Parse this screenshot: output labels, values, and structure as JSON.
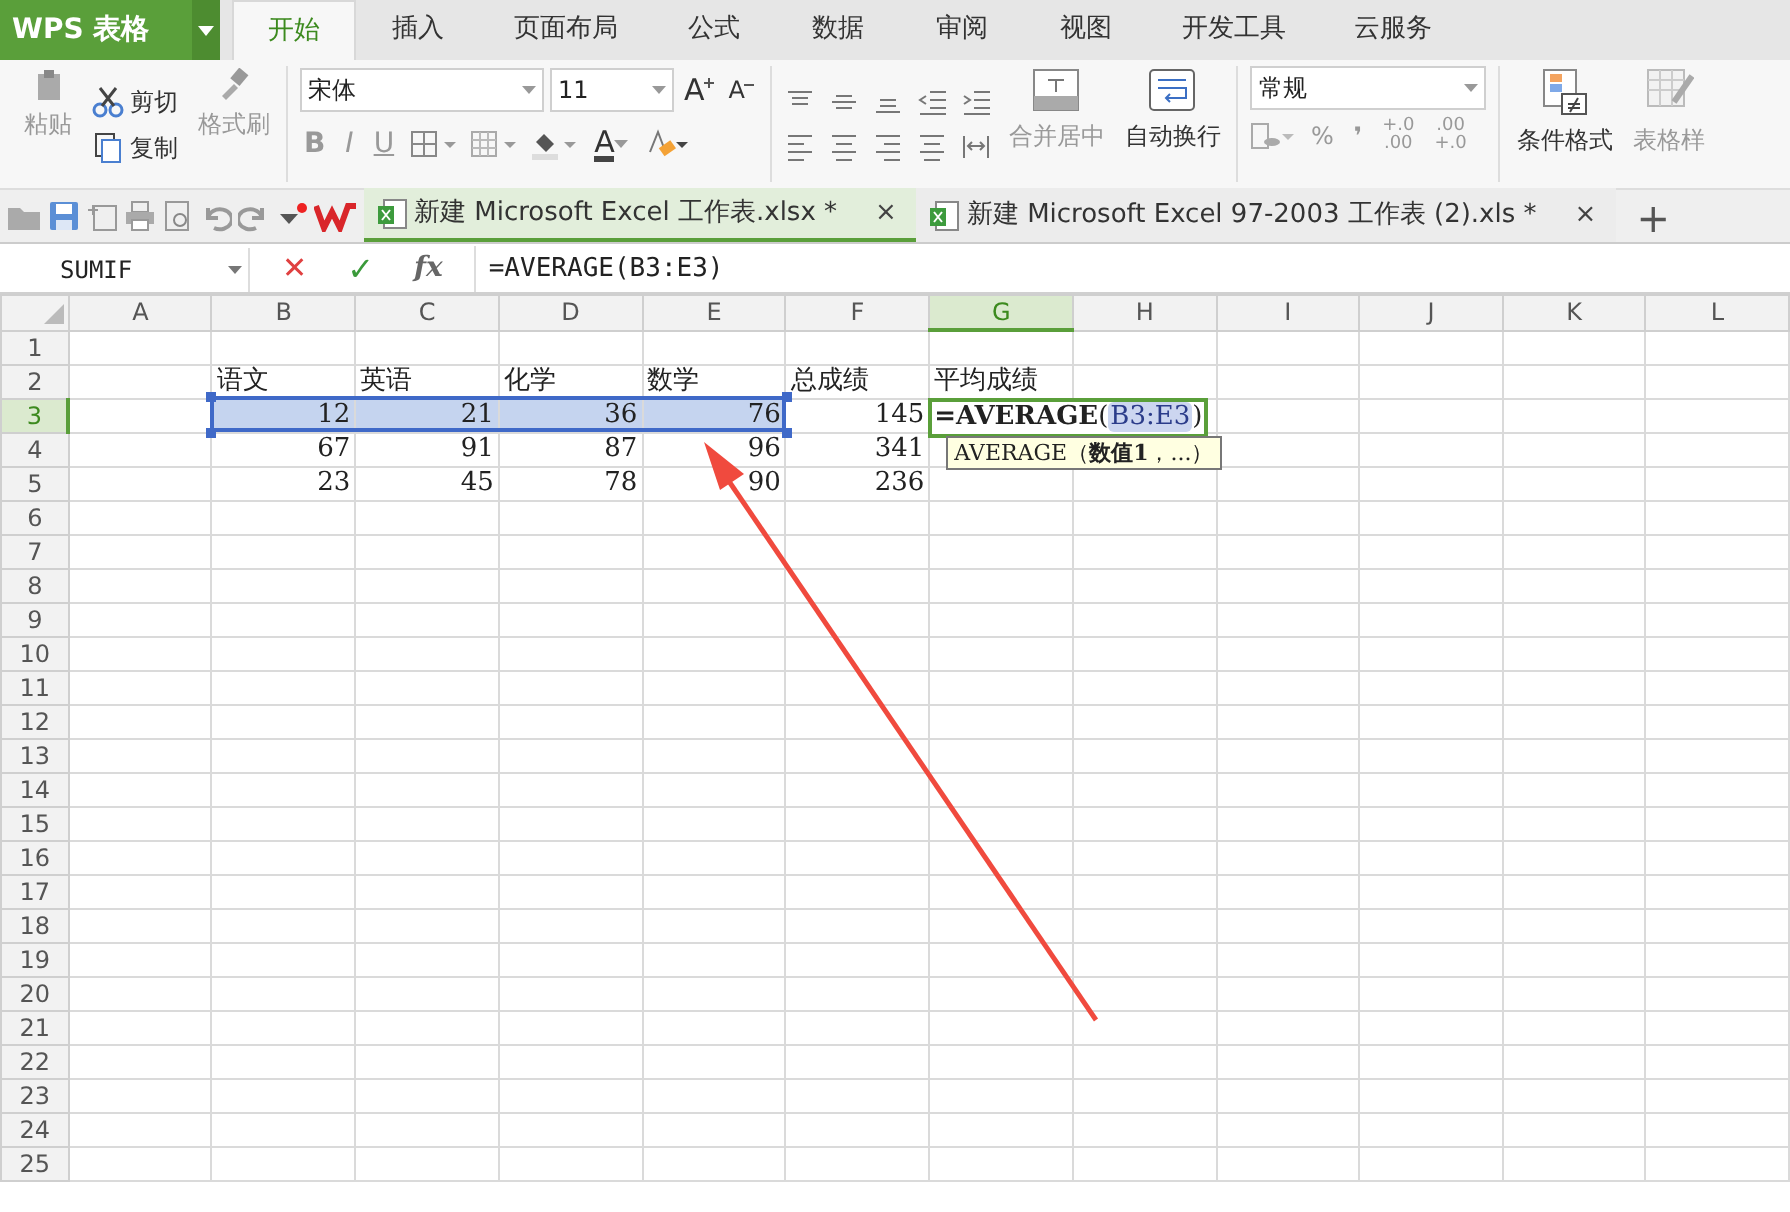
{
  "app": {
    "logo": "WPS 表格",
    "menu_tabs": [
      {
        "label": "开始",
        "selected": true
      },
      {
        "label": "插入",
        "selected": false
      },
      {
        "label": "页面布局",
        "selected": false
      },
      {
        "label": "公式",
        "selected": false
      },
      {
        "label": "数据",
        "selected": false
      },
      {
        "label": "审阅",
        "selected": false
      },
      {
        "label": "视图",
        "selected": false
      },
      {
        "label": "开发工具",
        "selected": false
      },
      {
        "label": "云服务",
        "selected": false
      }
    ]
  },
  "ribbon": {
    "clipboard": {
      "paste": "粘贴",
      "cut": "剪切",
      "copy": "复制",
      "format_painter": "格式刷"
    },
    "font": {
      "name": "宋体",
      "size": "11",
      "grow": "A",
      "shrink": "A",
      "styles": [
        "B",
        "I",
        "U"
      ],
      "color_letter": "A"
    },
    "alignment": {
      "merge": "合并居中",
      "wrap": "自动换行"
    },
    "number": {
      "format": "常规",
      "percent": "%",
      "comma": "❜",
      "decimals": [
        {
          "top": "+.0",
          "bottom": ".00"
        },
        {
          "top": ".00",
          "bottom": "+.0"
        }
      ]
    },
    "styles": {
      "conditional": "条件格式",
      "table_style": "表格样"
    }
  },
  "documents": [
    {
      "title": "新建 Microsoft Excel 工作表.xlsx *",
      "close": "×",
      "selected": true
    },
    {
      "title": "新建 Microsoft Excel 97-2003 工作表 (2).xls *",
      "close": "×",
      "selected": false
    }
  ],
  "new_tab": "+",
  "formula_bar": {
    "name_box": "SUMIF",
    "cancel": "✕",
    "enter": "✓",
    "fx": "fx",
    "formula": "=AVERAGE(B3:E3)"
  },
  "sheet": {
    "columns": [
      {
        "label": "A",
        "selected": false
      },
      {
        "label": "B",
        "selected": false
      },
      {
        "label": "C",
        "selected": false
      },
      {
        "label": "D",
        "selected": false
      },
      {
        "label": "E",
        "selected": false
      },
      {
        "label": "F",
        "selected": false
      },
      {
        "label": "G",
        "selected": true
      },
      {
        "label": "H",
        "selected": false
      },
      {
        "label": "I",
        "selected": false
      },
      {
        "label": "J",
        "selected": false
      },
      {
        "label": "K",
        "selected": false
      },
      {
        "label": "L",
        "selected": false
      }
    ],
    "rows": [
      {
        "label": "1",
        "selected": false
      },
      {
        "label": "2",
        "selected": false,
        "cells": [
          null,
          {
            "text": "语文",
            "kind": "text",
            "highlighted": false
          },
          {
            "text": "英语",
            "kind": "text",
            "highlighted": false
          },
          {
            "text": "化学",
            "kind": "text",
            "highlighted": false
          },
          {
            "text": "数学",
            "kind": "text",
            "highlighted": false
          },
          {
            "text": "总成绩",
            "kind": "text",
            "highlighted": false
          },
          {
            "text": "平均成绩",
            "kind": "text",
            "highlighted": false
          }
        ]
      },
      {
        "label": "3",
        "selected": true,
        "cells": [
          null,
          {
            "text": "12",
            "kind": "number",
            "highlighted": true
          },
          {
            "text": "21",
            "kind": "number",
            "highlighted": true
          },
          {
            "text": "36",
            "kind": "number",
            "highlighted": true
          },
          {
            "text": "76",
            "kind": "number",
            "highlighted": true
          },
          {
            "text": "145",
            "kind": "number",
            "highlighted": false
          },
          {
            "kind": "formula",
            "function": "=AVERAGE",
            "open": "(",
            "reference": "B3:E3",
            "close": ")",
            "highlighted": false
          }
        ]
      },
      {
        "label": "4",
        "selected": false,
        "cells": [
          null,
          {
            "text": "67",
            "kind": "number",
            "highlighted": false
          },
          {
            "text": "91",
            "kind": "number",
            "highlighted": false
          },
          {
            "text": "87",
            "kind": "number",
            "highlighted": false
          },
          {
            "text": "96",
            "kind": "number",
            "highlighted": false
          },
          {
            "text": "341",
            "kind": "number",
            "highlighted": false
          }
        ]
      },
      {
        "label": "5",
        "selected": false,
        "cells": [
          null,
          {
            "text": "23",
            "kind": "number",
            "highlighted": false
          },
          {
            "text": "45",
            "kind": "number",
            "highlighted": false
          },
          {
            "text": "78",
            "kind": "number",
            "highlighted": false
          },
          {
            "text": "90",
            "kind": "number",
            "highlighted": false
          },
          {
            "text": "236",
            "kind": "number",
            "highlighted": false
          }
        ]
      },
      {
        "label": "6",
        "selected": false
      },
      {
        "label": "7",
        "selected": false
      },
      {
        "label": "8",
        "selected": false
      },
      {
        "label": "9",
        "selected": false
      },
      {
        "label": "10",
        "selected": false
      },
      {
        "label": "11",
        "selected": false
      },
      {
        "label": "12",
        "selected": false
      },
      {
        "label": "13",
        "selected": false
      },
      {
        "label": "14",
        "selected": false
      },
      {
        "label": "15",
        "selected": false
      },
      {
        "label": "16",
        "selected": false
      },
      {
        "label": "17",
        "selected": false
      },
      {
        "label": "18",
        "selected": false
      },
      {
        "label": "19",
        "selected": false
      },
      {
        "label": "20",
        "selected": false
      },
      {
        "label": "21",
        "selected": false
      },
      {
        "label": "22",
        "selected": false
      },
      {
        "label": "23",
        "selected": false
      },
      {
        "label": "24",
        "selected": false
      },
      {
        "label": "25",
        "selected": false
      }
    ],
    "tooltip": "AVERAGE（**数值1**，...）",
    "annotations": [
      {
        "kind": "arrow",
        "color": "#f04a3e"
      }
    ]
  }
}
